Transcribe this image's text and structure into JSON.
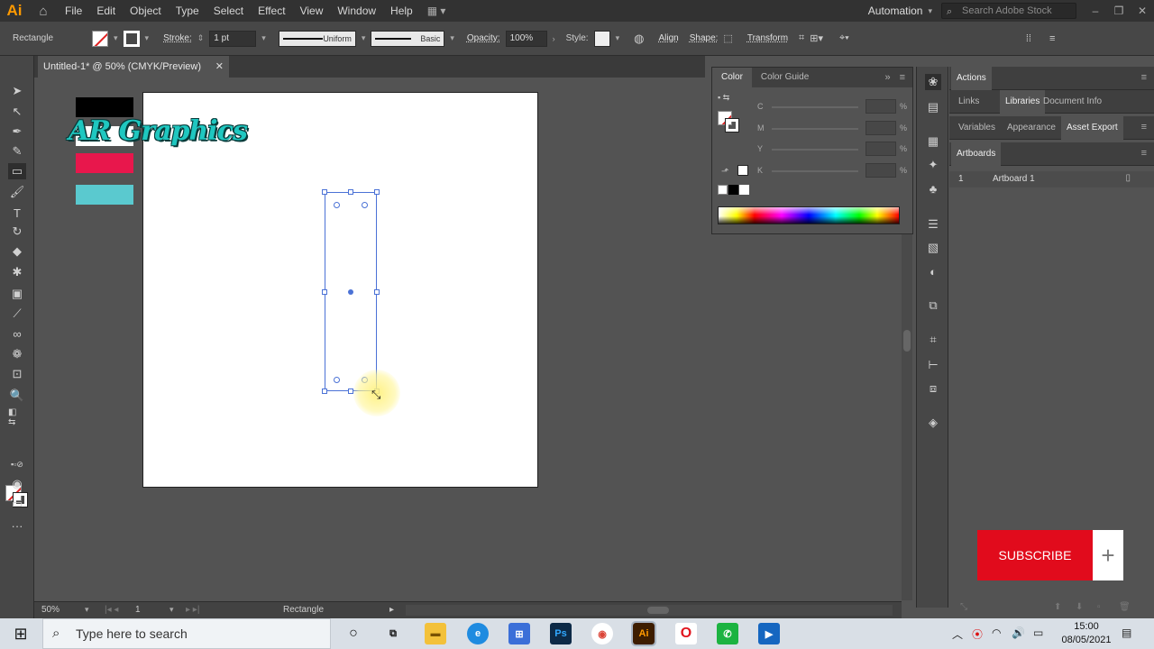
{
  "app": {
    "logo": "Ai",
    "menu": [
      "File",
      "Edit",
      "Object",
      "Type",
      "Select",
      "Effect",
      "View",
      "Window",
      "Help"
    ],
    "workspace": "Automation",
    "search_placeholder": "Search Adobe Stock"
  },
  "controlbar": {
    "tool_name": "Rectangle",
    "stroke_label": "Stroke:",
    "stroke_weight": "1 pt",
    "stroke_profile": "Uniform",
    "brush": "Basic",
    "opacity_label": "Opacity:",
    "opacity_value": "100%",
    "style_label": "Style:",
    "align_label": "Align",
    "shape_label": "Shape:",
    "transform_label": "Transform"
  },
  "document": {
    "tab_title": "Untitled-1* @ 50% (CMYK/Preview)",
    "logo_text": "AR Graphics",
    "swatch_colors": [
      "#000000",
      "#ffffff",
      "#e8174c",
      "#5ac9cf"
    ]
  },
  "statusbar": {
    "zoom": "50%",
    "artboard_num": "1",
    "tool": "Rectangle"
  },
  "color_panel": {
    "tabs": [
      "Color",
      "Color Guide"
    ],
    "channels": [
      "C",
      "M",
      "Y",
      "K"
    ],
    "unit": "%"
  },
  "right_panel": {
    "top_tabs": [
      "Actions"
    ],
    "mid_tabs": [
      "Links",
      "Libraries",
      "Document Info"
    ],
    "lower_tabs": [
      "Variables",
      "Appearance",
      "Asset Export"
    ],
    "artboards_title": "Artboards",
    "artboards": [
      {
        "num": "1",
        "name": "Artboard 1"
      }
    ]
  },
  "overlay": {
    "subscribe": "SUBSCRIBE",
    "plus": "+"
  },
  "taskbar": {
    "search_placeholder": "Type here to search",
    "time": "15:00",
    "date": "08/05/2021"
  }
}
